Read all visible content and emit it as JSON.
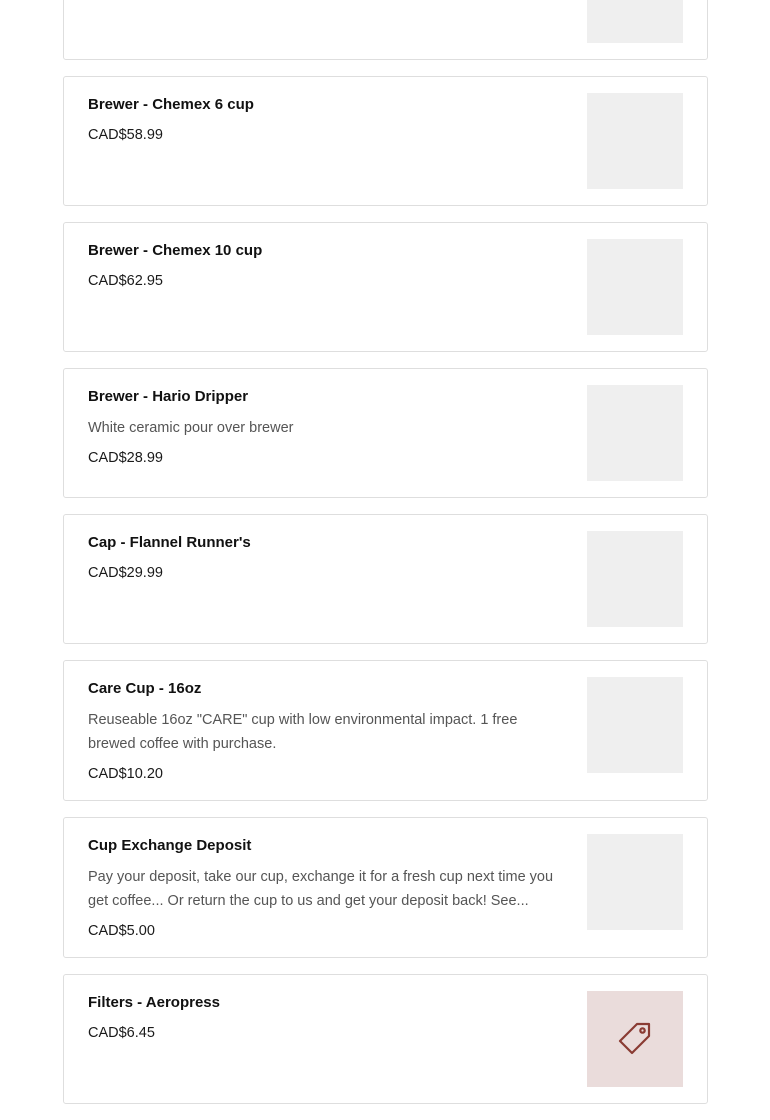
{
  "products": [
    {
      "name": "",
      "description": "",
      "price": ""
    },
    {
      "name": "Brewer - Chemex 6 cup",
      "description": "",
      "price": "CAD$58.99"
    },
    {
      "name": "Brewer - Chemex 10 cup",
      "description": "",
      "price": "CAD$62.95"
    },
    {
      "name": "Brewer - Hario Dripper",
      "description": "White ceramic pour over brewer",
      "price": "CAD$28.99"
    },
    {
      "name": "Cap - Flannel Runner's",
      "description": "",
      "price": "CAD$29.99"
    },
    {
      "name": "Care Cup - 16oz",
      "description": "Reuseable 16oz \"CARE\" cup with low environmental impact. 1 free brewed coffee with purchase.",
      "price": "CAD$10.20"
    },
    {
      "name": "Cup Exchange Deposit",
      "description": "Pay your deposit, take our cup, exchange it for a fresh cup next time you get coffee... Or return the cup to us and get your deposit back! See...",
      "price": "CAD$5.00"
    },
    {
      "name": "Filters - Aeropress",
      "description": "",
      "price": "CAD$6.45"
    }
  ],
  "colors": {
    "placeholder_bg": "#efefef",
    "tag_placeholder_bg": "#eadcdb",
    "tag_icon": "#8a3b33"
  },
  "icons": {
    "filters_aeropress_thumb": "price-tag-icon"
  }
}
